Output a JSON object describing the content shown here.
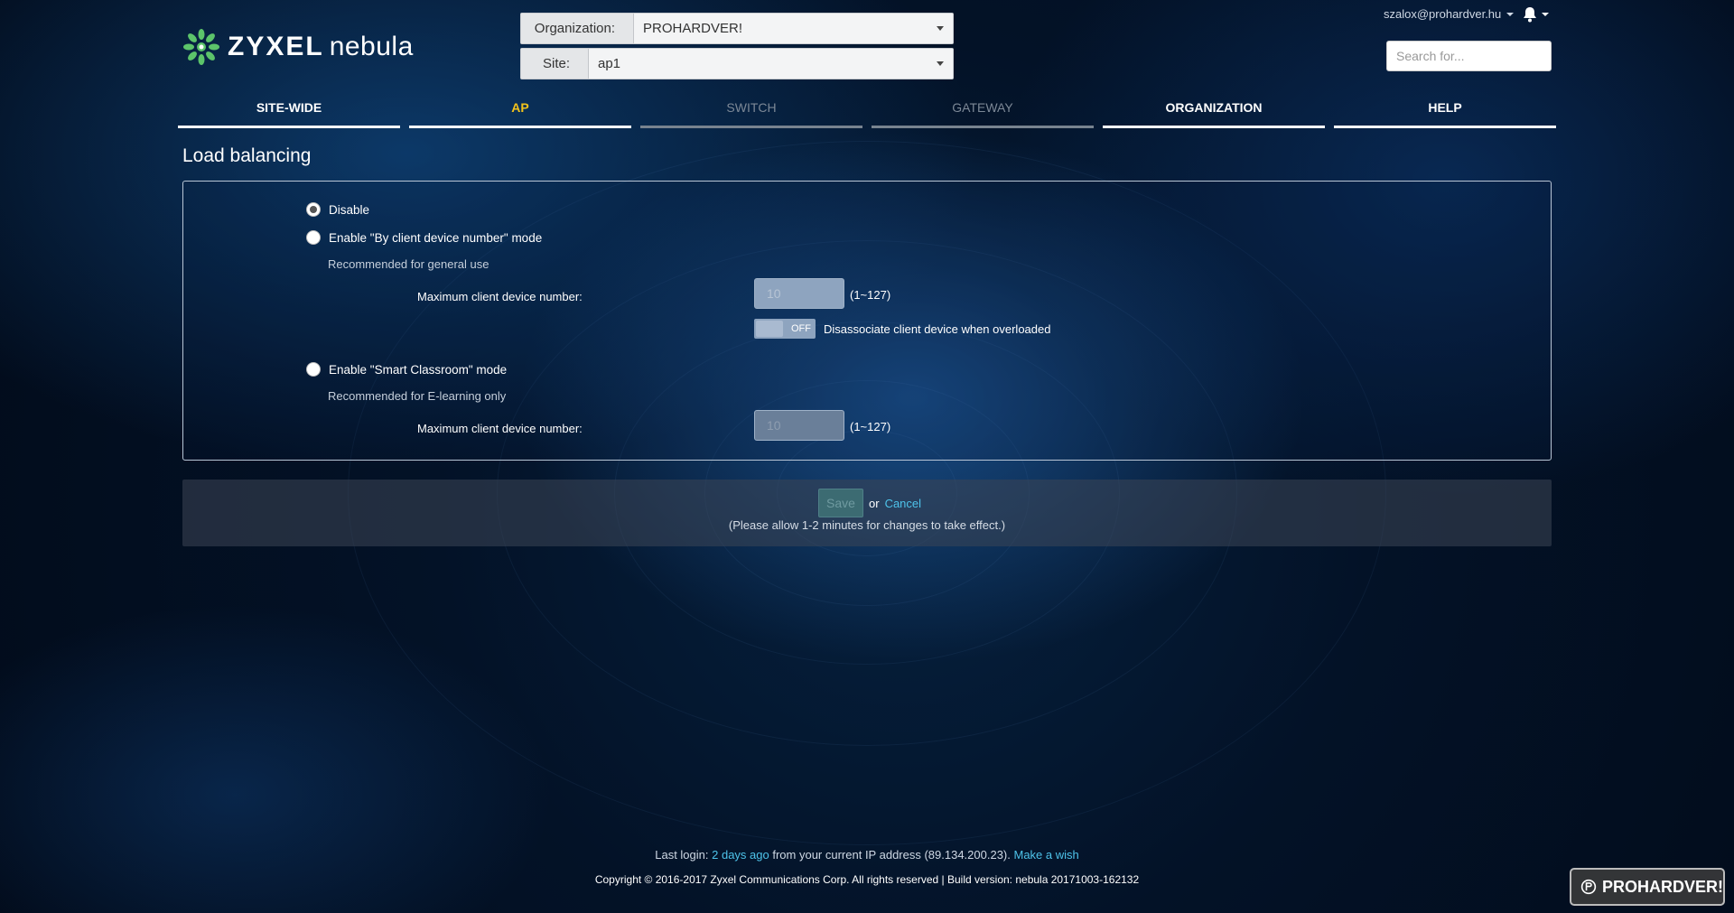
{
  "brand": {
    "name_part1": "ZYXEL",
    "name_part2": "nebula"
  },
  "header": {
    "organization_label": "Organization:",
    "organization_value": "PROHARDVER!",
    "site_label": "Site:",
    "site_value": "ap1",
    "user_name": "szalox@prohardver.hu",
    "search_placeholder": "Search for..."
  },
  "tabs": [
    {
      "label": "SITE-WIDE",
      "state": "normal"
    },
    {
      "label": "AP",
      "state": "active"
    },
    {
      "label": "SWITCH",
      "state": "disabled"
    },
    {
      "label": "GATEWAY",
      "state": "disabled"
    },
    {
      "label": "ORGANIZATION",
      "state": "normal"
    },
    {
      "label": "HELP",
      "state": "normal"
    }
  ],
  "page": {
    "title": "Load balancing"
  },
  "options": {
    "disable_label": "Disable",
    "client_mode_label": "Enable \"By client device number\" mode",
    "client_mode_hint": "Recommended for general use",
    "client_max_label": "Maximum client device number:",
    "client_max_value": "10",
    "client_max_range": "(1~127)",
    "toggle_state": "OFF",
    "toggle_label": "Disassociate client device when overloaded",
    "classroom_label": "Enable \"Smart Classroom\" mode",
    "classroom_hint": "Recommended for E-learning only",
    "classroom_max_label": "Maximum client device number:",
    "classroom_max_value": "10",
    "classroom_max_range": "(1~127)",
    "selected": "disable"
  },
  "savebar": {
    "save_label": "Save",
    "or_text": "or",
    "cancel_label": "Cancel",
    "note": "(Please allow 1-2 minutes for changes to take effect.)"
  },
  "footer": {
    "last_login_prefix": "Last login:",
    "last_login_link": "2 days ago",
    "last_login_suffix": "from your current IP address (89.134.200.23).",
    "wish_link": "Make a wish",
    "copyright": "Copyright © 2016-2017 Zyxel Communications Corp. All rights reserved | Build version: nebula 20171003-162132"
  },
  "watermark": {
    "text": "PROHARDVER!"
  },
  "colors": {
    "accent": "#f2c21b",
    "link": "#4ec3ea"
  }
}
